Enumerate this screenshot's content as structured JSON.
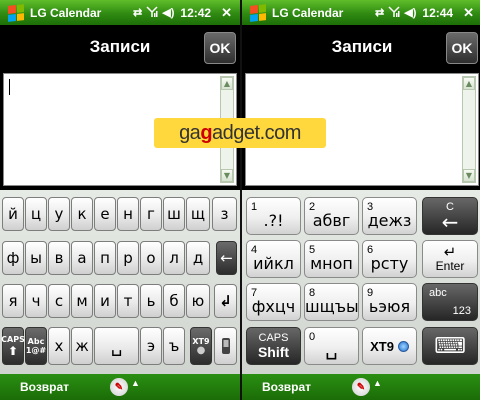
{
  "screens": [
    {
      "app_title": "LG Calendar",
      "time": "12:42",
      "close_label": "✕",
      "title": "Записи",
      "ok_label": "OK",
      "softkey_left": "Возврат",
      "keyboard": "russian-qwerty",
      "rows": [
        [
          "й",
          "ц",
          "у",
          "к",
          "е",
          "н",
          "г",
          "ш",
          "щ",
          "з"
        ],
        [
          "ф",
          "ы",
          "в",
          "а",
          "п",
          "р",
          "о",
          "л",
          "д",
          "←"
        ],
        [
          "я",
          "ч",
          "с",
          "м",
          "и",
          "т",
          "ь",
          "б",
          "ю",
          "↲"
        ]
      ],
      "bottom_keys": {
        "caps_top": "CAPS",
        "caps_arrow": "⬆",
        "sym_top": "Abc",
        "sym_bottom": "1@#",
        "zh": "ж",
        "x": "х",
        "space": "␣",
        "e": "э",
        "hard": "ъ",
        "xt9": "XT9",
        "xt9_dot": "●"
      }
    },
    {
      "app_title": "LG Calendar",
      "time": "12:44",
      "close_label": "✕",
      "title": "Записи",
      "ok_label": "OK",
      "softkey_left": "Возврат",
      "keyboard": "t9",
      "t9_keys": [
        {
          "num": "1",
          "letters": ".?!"
        },
        {
          "num": "2",
          "letters": "абвг"
        },
        {
          "num": "3",
          "letters": "дежз"
        },
        {
          "num": "4",
          "letters": "ийкл"
        },
        {
          "num": "5",
          "letters": "мноп"
        },
        {
          "num": "6",
          "letters": "рсту"
        },
        {
          "num": "7",
          "letters": "фхцч"
        },
        {
          "num": "8",
          "letters": "шщъы"
        },
        {
          "num": "9",
          "letters": "ьэюя"
        }
      ],
      "backspace_top": "C",
      "backspace_arrow": "←",
      "enter_label": "Enter",
      "enter_arrow": "↵",
      "mode_top": "abc",
      "mode_bottom": "123",
      "caps_top": "CAPS",
      "caps_bottom": "Shift",
      "zero_num": "0",
      "zero_symbol": "␣",
      "xt9_label": "XT9",
      "keyboard_icon_label": "⌨"
    }
  ],
  "watermark": {
    "prefix": "ga",
    "g": "g",
    "suffix": "adget.com"
  }
}
